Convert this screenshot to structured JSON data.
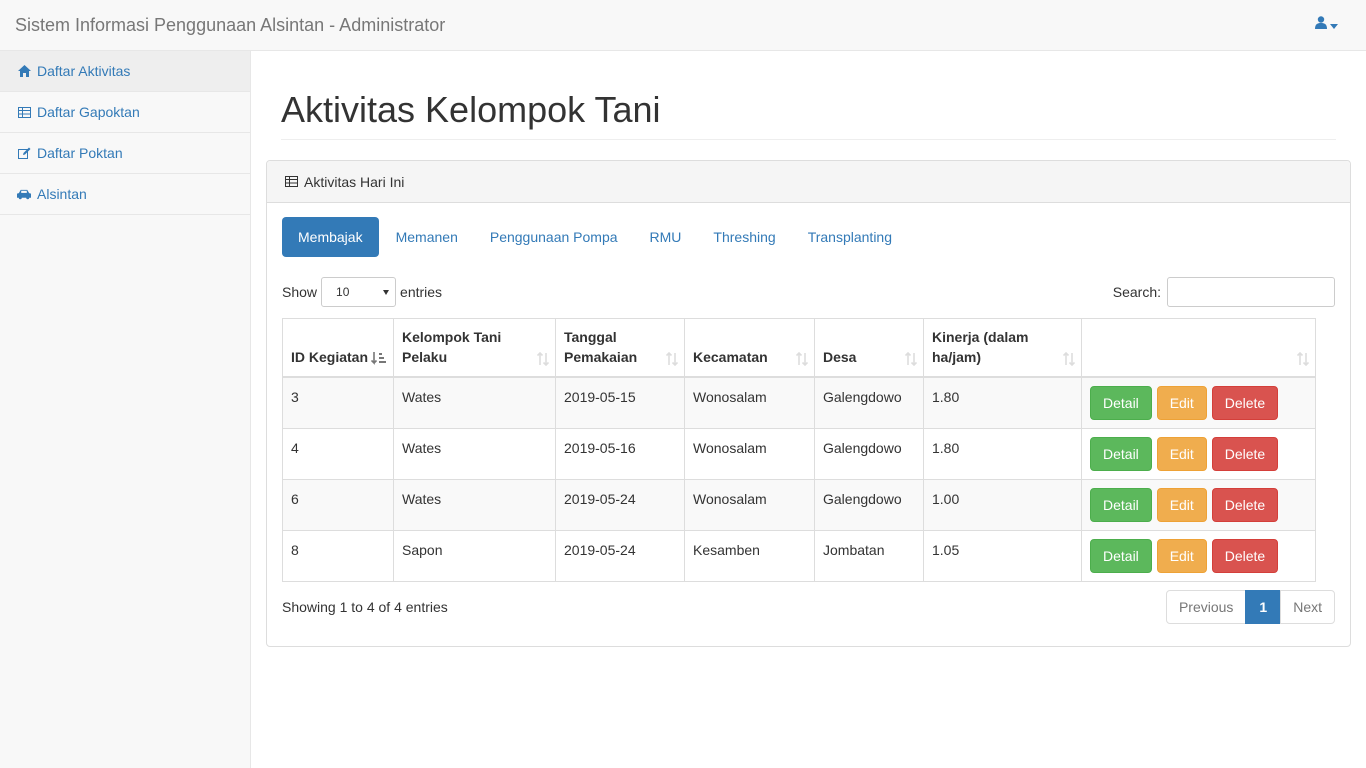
{
  "app_title": "Sistem Informasi Penggunaan Alsintan - Administrator",
  "user_menu": {
    "icon": "user-icon"
  },
  "sidebar": {
    "items": [
      {
        "label": "Daftar Aktivitas",
        "icon": "home-icon",
        "active": true
      },
      {
        "label": "Daftar Gapoktan",
        "icon": "table-icon"
      },
      {
        "label": "Daftar Poktan",
        "icon": "edit-icon"
      },
      {
        "label": "Alsintan",
        "icon": "car-icon"
      }
    ]
  },
  "page_title": "Aktivitas Kelompok Tani",
  "panel": {
    "heading": "Aktivitas Hari Ini",
    "icon": "table-icon"
  },
  "tabs": [
    "Membajak",
    "Memanen",
    "Penggunaan Pompa",
    "RMU",
    "Threshing",
    "Transplanting"
  ],
  "active_tab": "Membajak",
  "length": {
    "show": "Show",
    "value": "10",
    "entries": "entries"
  },
  "search": {
    "label": "Search:",
    "value": ""
  },
  "table": {
    "headers": [
      "ID Kegiatan",
      "Kelompok Tani Pelaku",
      "Tanggal Pemakaian",
      "Kecamatan",
      "Desa",
      "Kinerja (dalam ha/jam)",
      ""
    ],
    "sorted_column": "ID Kegiatan",
    "rows": [
      [
        "3",
        "Wates",
        "2019-05-15",
        "Wonosalam",
        "Galengdowo",
        "1.80"
      ],
      [
        "4",
        "Wates",
        "2019-05-16",
        "Wonosalam",
        "Galengdowo",
        "1.80"
      ],
      [
        "6",
        "Wates",
        "2019-05-24",
        "Wonosalam",
        "Galengdowo",
        "1.00"
      ],
      [
        "8",
        "Sapon",
        "2019-05-24",
        "Kesamben",
        "Jombatan",
        "1.05"
      ]
    ],
    "actions": {
      "detail": "Detail",
      "edit": "Edit",
      "delete": "Delete"
    }
  },
  "info": "Showing 1 to 4 of 4 entries",
  "pagination": {
    "previous": "Previous",
    "current": "1",
    "next": "Next"
  },
  "colors": {
    "primary": "#337ab7",
    "success": "#5cb85c",
    "warning": "#f0ad4e",
    "danger": "#d9534f"
  }
}
